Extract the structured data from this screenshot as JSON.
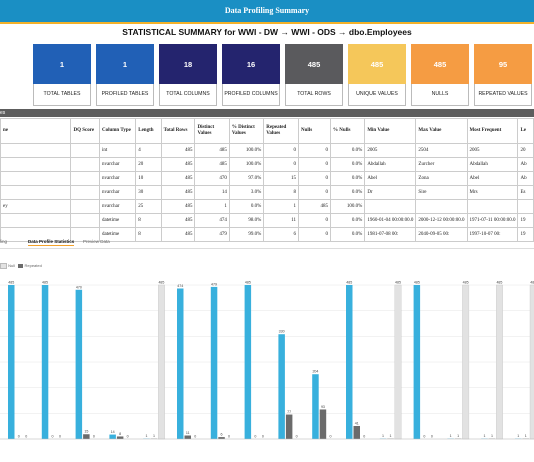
{
  "app_title": "Data Profiling Summary",
  "summary_title": "STATISTICAL SUMMARY for WWI - DW → WWI - ODS → dbo.Employees",
  "cards": [
    {
      "value": "1",
      "label": "TOTAL TABLES",
      "color": "#2160b6"
    },
    {
      "value": "1",
      "label": "PROFILED TABLES",
      "color": "#2160b6"
    },
    {
      "value": "18",
      "label": "TOTAL COLUMNS",
      "color": "#24246e"
    },
    {
      "value": "16",
      "label": "PROFILED COLUMNS",
      "color": "#24246e"
    },
    {
      "value": "485",
      "label": "TOTAL ROWS",
      "color": "#5a5a5d"
    },
    {
      "value": "485",
      "label": "UNIQUE VALUES",
      "color": "#f5c75a"
    },
    {
      "value": "485",
      "label": "NULLS",
      "color": "#f59c43"
    },
    {
      "value": "95",
      "label": "REPEATED VALUES",
      "color": "#f59c43"
    }
  ],
  "table_section_label": "es",
  "table": {
    "headers": [
      "ne",
      "DQ Score",
      "Column Type",
      "Length",
      "Total Rows",
      "Distinct Values",
      "% Distinct Values",
      "Repeated Values",
      "Nulls",
      "% Nulls",
      "Min Value",
      "Max Value",
      "Most Frequent",
      "Le"
    ],
    "rows": [
      [
        "",
        "",
        "int",
        "4",
        "485",
        "485",
        "100.0%",
        "0",
        "0",
        "0.0%",
        "2005",
        "2504",
        "2005",
        "20"
      ],
      [
        "",
        "",
        "nvarchar",
        "20",
        "485",
        "485",
        "100.0%",
        "0",
        "0",
        "0.0%",
        "Abdallah",
        "Zurcher",
        "Abdallah",
        "Ab"
      ],
      [
        "",
        "",
        "nvarchar",
        "10",
        "485",
        "470",
        "97.0%",
        "15",
        "0",
        "0.0%",
        "Abel",
        "Zona",
        "Abel",
        "Ab"
      ],
      [
        "",
        "",
        "nvarchar",
        "30",
        "485",
        "14",
        "3.0%",
        "8",
        "0",
        "0.0%",
        "Dr",
        "Sire",
        "Mrs",
        "Es"
      ],
      [
        "ey",
        "",
        "nvarchar",
        "25",
        "485",
        "1",
        "0.0%",
        "1",
        "485",
        "100.0%",
        "",
        "",
        "",
        ""
      ],
      [
        "",
        "",
        "datetime",
        "8",
        "485",
        "474",
        "98.0%",
        "11",
        "0",
        "0.0%",
        "1960-01-04 00:00:00.0",
        "2000-12-12 00:00:00.0",
        "1971-07-11 00:00:00.0",
        "19"
      ],
      [
        "",
        "",
        "datetime",
        "8",
        "485",
        "479",
        "99.0%",
        "6",
        "0",
        "0.0%",
        "1981-07-08 00:",
        "2040-09-05 00:",
        "1997-10-07 00:",
        "19"
      ]
    ]
  },
  "tabs": [
    "ling",
    "Data Profile Statistics",
    "Preview Data"
  ],
  "legend": {
    "null_label": "Null",
    "repeated_label": "Repeated"
  },
  "chart_data": {
    "type": "bar",
    "series": [
      {
        "name": "Null",
        "color": "#e2e2e2"
      },
      {
        "name": "Repeated",
        "color": "#6b6b6b"
      }
    ],
    "groups": [
      {
        "blue": 485,
        "repeated": 0,
        "null": 0
      },
      {
        "blue": 485,
        "repeated": 0,
        "null": 0
      },
      {
        "blue": 470,
        "repeated": 15,
        "null": 0
      },
      {
        "blue": 14,
        "repeated": 8,
        "null": 0
      },
      {
        "blue": 1,
        "repeated": 1,
        "null": 485
      },
      {
        "blue": 474,
        "repeated": 11,
        "null": 0
      },
      {
        "blue": 479,
        "repeated": 6,
        "null": 0
      },
      {
        "blue": 485,
        "repeated": 0,
        "null": 0
      },
      {
        "blue": 330,
        "repeated": 77,
        "null": 0
      },
      {
        "blue": 204,
        "repeated": 93,
        "null": 0
      },
      {
        "blue": 485,
        "repeated": 41,
        "null": 0
      },
      {
        "blue": 1,
        "repeated": 1,
        "null": 485
      },
      {
        "blue": 485,
        "repeated": 0,
        "null": 0
      },
      {
        "blue": 1,
        "repeated": 1,
        "null": 485
      },
      {
        "blue": 1,
        "repeated": 1,
        "null": 485
      },
      {
        "blue": 1,
        "repeated": 1,
        "null": 485
      }
    ],
    "ymax": 485,
    "grid": true
  }
}
